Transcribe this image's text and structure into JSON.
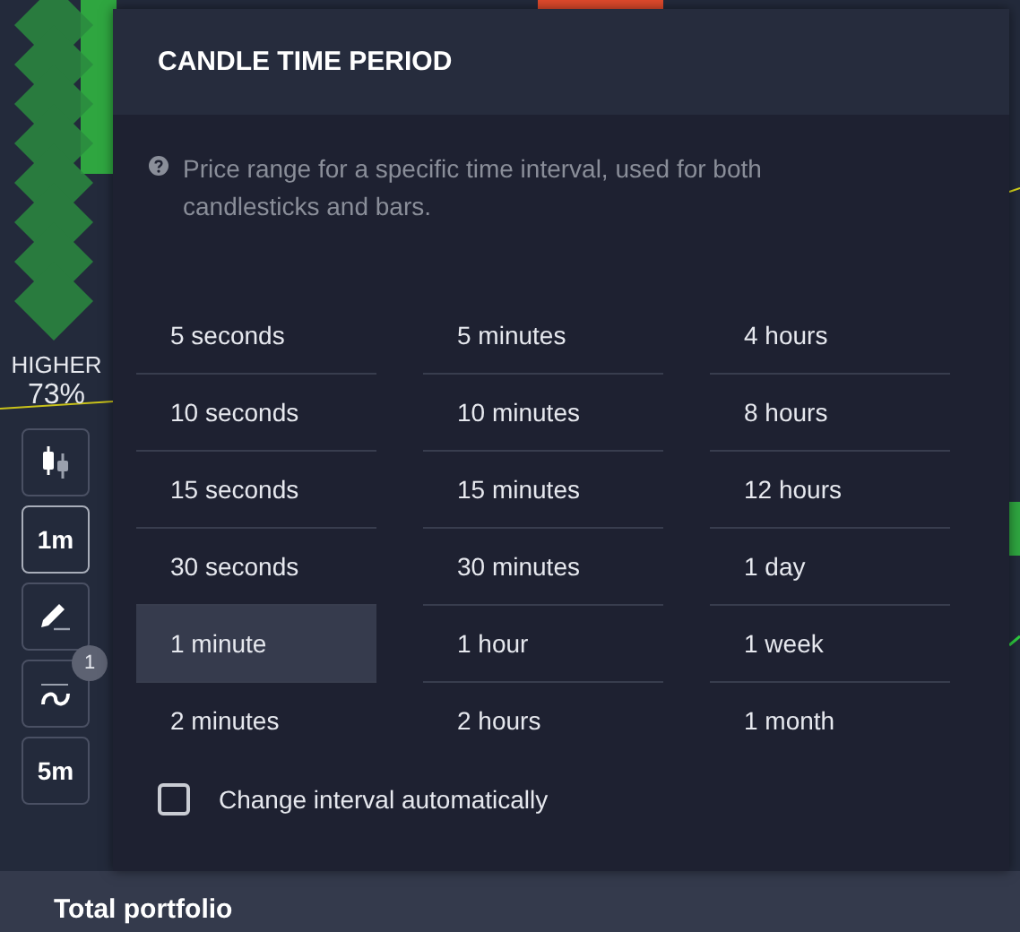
{
  "sidebar": {
    "signal_label": "HIGHER",
    "signal_percent": "73%",
    "tools": [
      {
        "kind": "candles",
        "selected": false
      },
      {
        "kind": "text",
        "label": "1m",
        "selected": true
      },
      {
        "kind": "pencil",
        "selected": false
      },
      {
        "kind": "indicator",
        "badge": "1",
        "selected": false
      },
      {
        "kind": "text",
        "label": "5m",
        "selected": false
      }
    ]
  },
  "panel": {
    "title": "CANDLE TIME PERIOD",
    "hint": "Price range for a specific time interval, used for both candlesticks and bars.",
    "columns": [
      [
        {
          "label": "5 seconds",
          "selected": false
        },
        {
          "label": "10 seconds",
          "selected": false
        },
        {
          "label": "15 seconds",
          "selected": false
        },
        {
          "label": "30 seconds",
          "selected": false
        },
        {
          "label": "1 minute",
          "selected": true
        },
        {
          "label": "2 minutes",
          "selected": false
        }
      ],
      [
        {
          "label": "5 minutes",
          "selected": false
        },
        {
          "label": "10 minutes",
          "selected": false
        },
        {
          "label": "15 minutes",
          "selected": false
        },
        {
          "label": "30 minutes",
          "selected": false
        },
        {
          "label": "1 hour",
          "selected": false
        },
        {
          "label": "2 hours",
          "selected": false
        }
      ],
      [
        {
          "label": "4 hours",
          "selected": false
        },
        {
          "label": "8 hours",
          "selected": false
        },
        {
          "label": "12 hours",
          "selected": false
        },
        {
          "label": "1 day",
          "selected": false
        },
        {
          "label": "1 week",
          "selected": false
        },
        {
          "label": "1 month",
          "selected": false
        }
      ]
    ],
    "auto_interval": {
      "label": "Change interval automatically",
      "checked": false
    }
  },
  "bottom_bar": {
    "label": "Total portfolio"
  }
}
